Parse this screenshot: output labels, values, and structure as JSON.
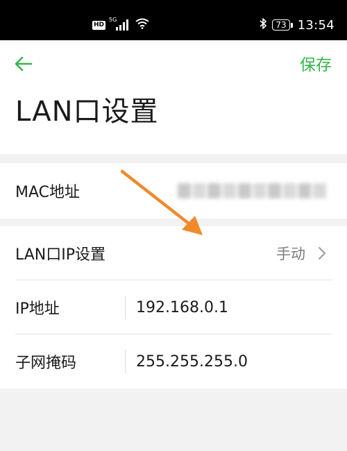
{
  "status_bar": {
    "hd": "HD",
    "network": "5G",
    "battery": "73",
    "time": "13:54",
    "icons": [
      "hd-icon",
      "signal-5g-icon",
      "wifi-icon",
      "bluetooth-icon",
      "battery-icon"
    ]
  },
  "header": {
    "back_icon": "back-arrow-icon",
    "save_label": "保存",
    "title": "LAN口设置"
  },
  "rows": {
    "mac": {
      "label": "MAC地址",
      "value_hidden": true
    },
    "lan_ip_mode": {
      "label": "LAN口IP设置",
      "value": "手动",
      "icon": "chevron-right-icon"
    },
    "ip": {
      "label": "IP地址",
      "value": "192.168.0.1"
    },
    "mask": {
      "label": "子网掩码",
      "value": "255.255.255.0"
    }
  },
  "colors": {
    "accent": "#33b54a",
    "annotation_arrow": "#f08a2c",
    "background": "#f2f2f2",
    "status_bar": "#000000"
  }
}
